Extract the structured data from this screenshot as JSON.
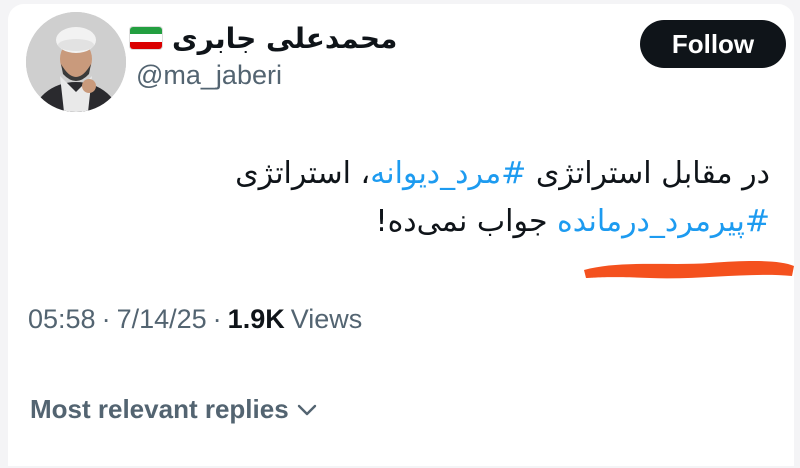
{
  "author": {
    "display_name": "محمدعلی جابری",
    "handle": "@ma_jaberi",
    "flag_icon": "iran-flag-icon",
    "avatar_icon": "avatar-photo"
  },
  "follow_button": {
    "label": "Follow"
  },
  "tweet": {
    "line1": {
      "t1": "در مقابل استراتژی ",
      "hashtag": "#مرد_دیوانه",
      "t2": "، استراتژی"
    },
    "line2": {
      "hashtag": "#پیرمرد_درمانده",
      "t1": " جواب نمی‌ده!"
    },
    "highlight_color": "#f4511e"
  },
  "meta": {
    "time": "05:58",
    "sep1": "·",
    "date": "7/14/25",
    "sep2": "·",
    "views_count": "1.9K",
    "views_label": "Views"
  },
  "replies": {
    "label": "Most relevant replies",
    "icon": "chevron-down-icon"
  },
  "colors": {
    "hashtag": "#1d9bf0",
    "secondary_text": "#536471",
    "follow_bg": "#0f1419"
  }
}
